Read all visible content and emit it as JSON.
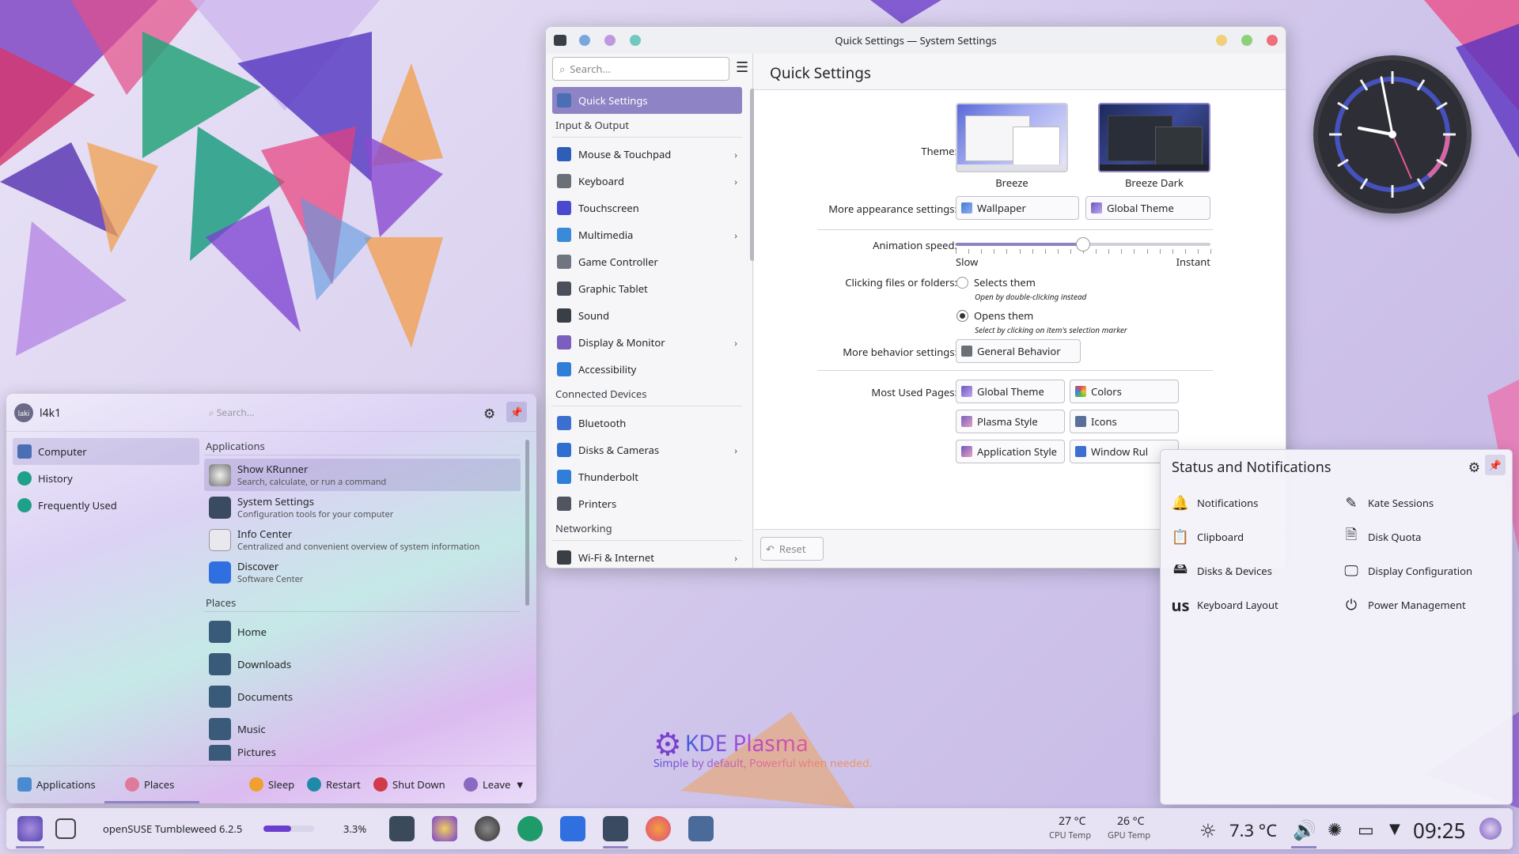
{
  "window": {
    "title": "Quick Settings — System Settings",
    "search_placeholder": "Search...",
    "page_title": "Quick Settings",
    "nav": [
      {
        "label": "Quick Settings",
        "selected": true,
        "chevron": false,
        "icon": "quick-settings-icon",
        "color": "#4a6fb5"
      },
      {
        "section": "Input & Output"
      },
      {
        "label": "Mouse & Touchpad",
        "chevron": true,
        "icon": "mouse-icon",
        "color": "#2d5fb8"
      },
      {
        "label": "Keyboard",
        "chevron": true,
        "icon": "keyboard-icon",
        "color": "#6a6f78"
      },
      {
        "label": "Touchscreen",
        "chevron": false,
        "icon": "touchscreen-icon",
        "color": "#4a4ad0"
      },
      {
        "label": "Multimedia",
        "chevron": true,
        "icon": "multimedia-icon",
        "color": "#3b8ad9"
      },
      {
        "label": "Game Controller",
        "chevron": false,
        "icon": "gamepad-icon",
        "color": "#707580"
      },
      {
        "label": "Graphic Tablet",
        "chevron": false,
        "icon": "tablet-icon",
        "color": "#4a4f5a"
      },
      {
        "label": "Sound",
        "chevron": false,
        "icon": "sound-icon",
        "color": "#3a3f46"
      },
      {
        "label": "Display & Monitor",
        "chevron": true,
        "icon": "display-icon",
        "color": "#7a5ec0"
      },
      {
        "label": "Accessibility",
        "chevron": false,
        "icon": "accessibility-icon",
        "color": "#2f7ed8"
      },
      {
        "section": "Connected Devices"
      },
      {
        "label": "Bluetooth",
        "chevron": false,
        "icon": "bluetooth-icon",
        "color": "#3b6fd0"
      },
      {
        "label": "Disks & Cameras",
        "chevron": true,
        "icon": "disks-icon",
        "color": "#2f6fd0"
      },
      {
        "label": "Thunderbolt",
        "chevron": false,
        "icon": "thunderbolt-icon",
        "color": "#2f7ed8"
      },
      {
        "label": "Printers",
        "chevron": false,
        "icon": "printer-icon",
        "color": "#505560"
      },
      {
        "section": "Networking"
      },
      {
        "label": "Wi-Fi & Internet",
        "chevron": true,
        "icon": "wifi-icon",
        "color": "#3a3f46"
      }
    ],
    "theme_label": "Theme:",
    "themes": [
      "Breeze",
      "Breeze Dark"
    ],
    "more_appearance_label": "More appearance settings:",
    "wallpaper_btn": "Wallpaper",
    "global_theme_btn": "Global Theme",
    "animation_label": "Animation speed:",
    "anim_slow": "Slow",
    "anim_instant": "Instant",
    "animation_value": 0.5,
    "clicking_label": "Clicking files or folders:",
    "opt1": "Selects them",
    "opt1_hint": "Open by double-clicking instead",
    "opt2": "Opens them",
    "opt2_hint": "Select by clicking on item's selection marker",
    "more_behavior_label": "More behavior settings:",
    "general_behavior_btn": "General Behavior",
    "most_used_label": "Most Used Pages:",
    "most_used": [
      "Global Theme",
      "Colors",
      "Plasma Style",
      "Icons",
      "Application Style",
      "Window Rul"
    ],
    "reset_btn": "Reset"
  },
  "status": {
    "title": "Status and Notifications",
    "items": [
      {
        "label": "Notifications",
        "icon": "bell-icon"
      },
      {
        "label": "Kate Sessions",
        "icon": "kate-icon"
      },
      {
        "label": "Clipboard",
        "icon": "clipboard-icon"
      },
      {
        "label": "Disk Quota",
        "icon": "disk-quota-icon"
      },
      {
        "label": "Disks & Devices",
        "icon": "disks-devices-icon"
      },
      {
        "label": "Display Configuration",
        "icon": "display-config-icon"
      },
      {
        "label": "Keyboard Layout",
        "icon": "keyboard-layout-icon",
        "glyph": "us"
      },
      {
        "label": "Power Management",
        "icon": "power-icon"
      }
    ]
  },
  "launcher": {
    "user": "l4k1",
    "avatar_text": "laki",
    "search_placeholder": "Search...",
    "side": [
      "Computer",
      "History",
      "Frequently Used"
    ],
    "apps_section": "Applications",
    "apps": [
      {
        "name": "Show KRunner",
        "desc": "Search, calculate, or run a command"
      },
      {
        "name": "System Settings",
        "desc": "Configuration tools for your computer"
      },
      {
        "name": "Info Center",
        "desc": "Centralized and convenient overview of system information"
      },
      {
        "name": "Discover",
        "desc": "Software Center"
      }
    ],
    "places_section": "Places",
    "places": [
      "Home",
      "Downloads",
      "Documents",
      "Music",
      "Pictures"
    ],
    "bottom": {
      "applications": "Applications",
      "places": "Places",
      "sleep": "Sleep",
      "restart": "Restart",
      "shutdown": "Shut Down",
      "leave": "Leave"
    }
  },
  "taskbar": {
    "update_text": "openSUSE Tumbleweed 6.2.5",
    "cpu_percent": "3.3%",
    "cpu_temp": "27 °C",
    "cpu_temp_label": "CPU Temp",
    "gpu_temp": "26 °C",
    "gpu_temp_label": "GPU Temp",
    "weather": "7.3 °C",
    "time": "09:25"
  },
  "kde": {
    "title": "KDE Plasma",
    "tagline": "Simple by default, Powerful when needed."
  }
}
